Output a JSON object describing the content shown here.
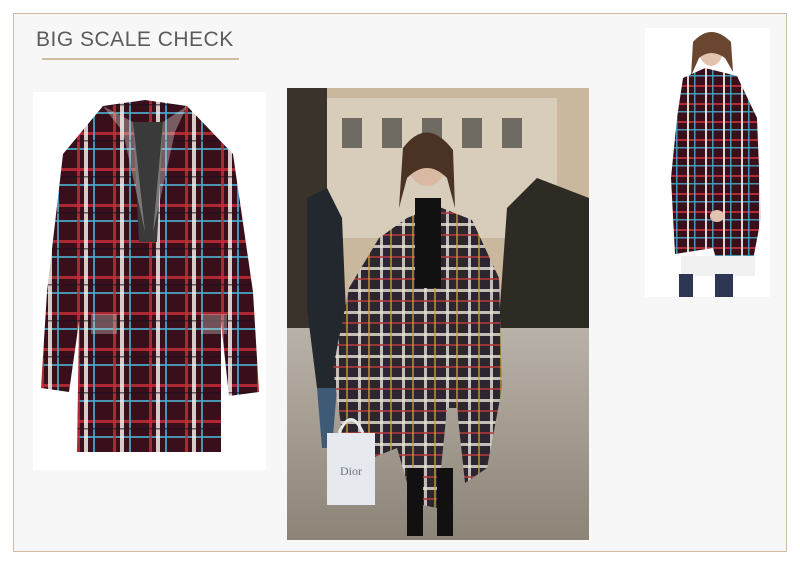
{
  "header": {
    "title": "BIG SCALE CHECK"
  },
  "photos": [
    {
      "name": "product-shot",
      "subject": "coat-flatlay"
    },
    {
      "name": "street-style",
      "subject": "model-walking",
      "bag_text": "Dior"
    },
    {
      "name": "model-shot",
      "subject": "model-side-view"
    }
  ],
  "colors": {
    "accent_rule": "#cdbf9d",
    "plaid_base": "#3a0f1c",
    "plaid_red": "#c8303a",
    "plaid_blue": "#4aa3c4",
    "plaid_white": "#f2ede6"
  }
}
